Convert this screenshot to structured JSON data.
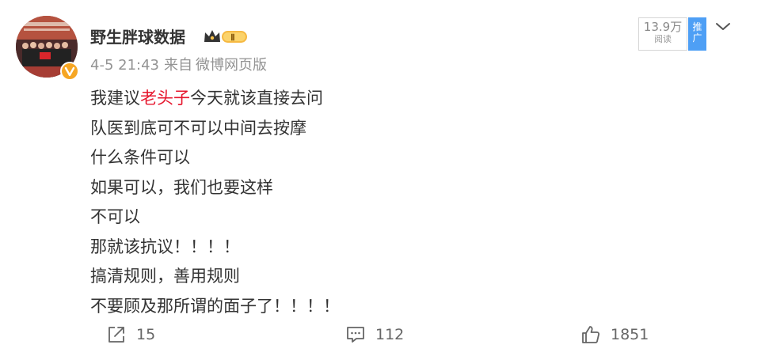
{
  "post": {
    "author": "野生胖球数据",
    "level_badge": "Ⅱ",
    "time": "4-5 21:43",
    "source_prefix": "来自",
    "source": "微博网页版",
    "read_count": "13.9万",
    "read_label": "阅读",
    "promote_tag": "推广",
    "text": {
      "line1_a": "我建议",
      "line1_highlight": "老头子",
      "line1_b": "今天就该直接去问",
      "line2": "队医到底可不可以中间去按摩",
      "line3": "什么条件可以",
      "line4": "如果可以，我们也要这样",
      "line5": "不可以",
      "line6": "那就该抗议！！！！",
      "line7": "搞清规则，善用规则",
      "line8": "不要顾及那所谓的面子了！！！！"
    },
    "highlight_color": "#e6162d"
  },
  "actions": {
    "reposts": "15",
    "comments": "112",
    "likes": "1851"
  },
  "icons": {
    "verified": "verified-v-icon",
    "level": "crown-level-icon",
    "menu": "chevron-down-icon",
    "repost": "repost-icon",
    "comment": "comment-icon",
    "like": "thumbs-up-icon"
  }
}
